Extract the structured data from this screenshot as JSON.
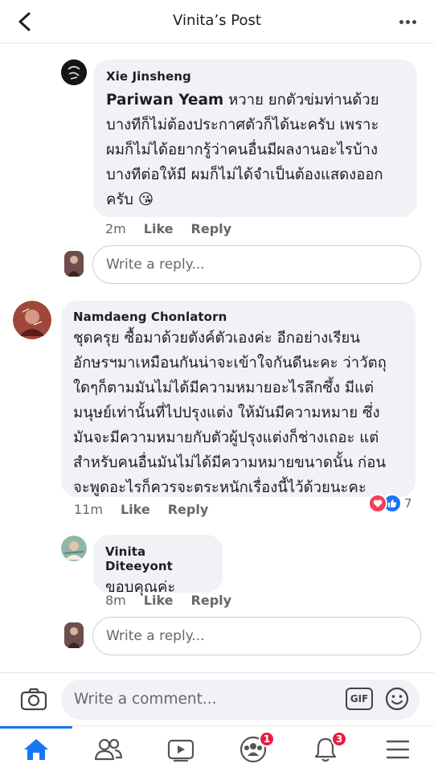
{
  "header": {
    "title": "Vinita’s Post"
  },
  "comments": [
    {
      "author": "Xie Jinsheng",
      "mention": "Pariwan Yeam",
      "lines": [
        " หวาย ยกตัวข่มท่านด้วย",
        "บางทีก็ไม่ต้องประกาศตัวก็ได้นะครับ เพราะ",
        "ผมก็ไม่ได้อยากรู้ว่าคนอื่นมีผลงานอะไรบ้าง",
        "บางทีต่อให้มี ผมก็ไม่ได้จำเป็นต้องแสดงออก",
        "ครับ 😘"
      ],
      "time": "2m",
      "like": "Like",
      "reply": "Reply"
    },
    {
      "author": "Namdaeng Chonlatorn",
      "lines": [
        "ชุดครุย ซื้อมาด้วยตังค์ตัวเองค่ะ อีกอย่างเรียน",
        "อักษรฯมาเหมือนกันน่าจะเข้าใจกันดีนะคะ ว่าวัตถุ",
        "ใดๆก็ตามมันไม่ได้มีความหมายอะไรลึกซึ้ง มีแต่",
        "มนุษย์เท่านั้นที่ไปปรุงแต่ง ให้มันมีความหมาย ซึ่ง",
        "มันจะมีความหมายกับตัวผู้ปรุงแต่งก็ช่างเถอะ แต่",
        "สำหรับคนอื่นมันไม่ได้มีความหมายขนาดนั้น ก่อน",
        "จะพูดอะไรก็ควรจะตระหนักเรื่องนี้ไว้ด้วยนะคะ"
      ],
      "time": "11m",
      "like": "Like",
      "reply": "Reply",
      "reaction_count": "7"
    },
    {
      "author": "Vinita Diteeyont",
      "lines": [
        "ขอบคุณค่ะ"
      ],
      "time": "8m",
      "like": "Like",
      "reply": "Reply"
    }
  ],
  "reply_placeholder": "Write a reply...",
  "composer": {
    "placeholder": "Write a comment...",
    "gif_label": "GIF"
  },
  "tabbar": {
    "groups_badge": "1",
    "notifications_badge": "3"
  },
  "colors": {
    "accent": "#1877f2",
    "badge": "#e41e3f",
    "bubble": "#f0f2f5"
  }
}
